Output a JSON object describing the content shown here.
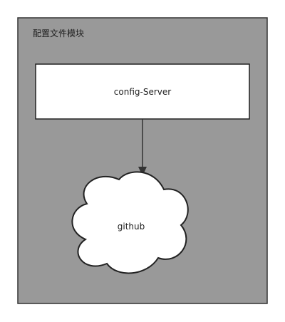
{
  "module": {
    "label": "配置文件模块",
    "background": "#999999",
    "border": "#333333"
  },
  "server": {
    "label": "config-Server",
    "fill": "#ffffff",
    "border": "#222222"
  },
  "repository": {
    "label": "github",
    "shape": "cloud",
    "fill": "#ffffff"
  },
  "connection": {
    "from": "config-Server",
    "to": "github",
    "style": "arrow",
    "color": "#333333"
  }
}
